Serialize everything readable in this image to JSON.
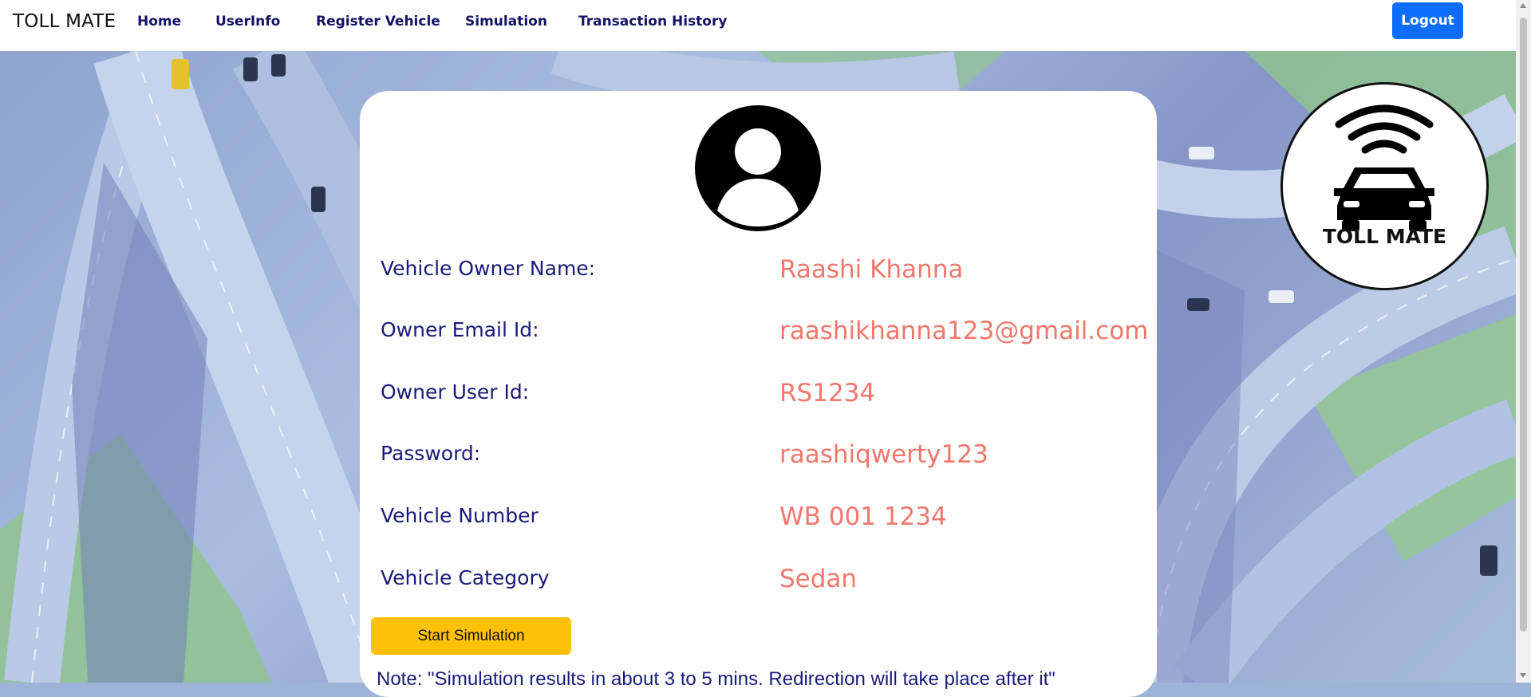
{
  "nav": {
    "brand": "TOLL MATE",
    "links": [
      "Home",
      "UserInfo",
      "Register Vehicle",
      "Simulation",
      "Transaction History"
    ],
    "logout_label": "Logout"
  },
  "profile": {
    "rows": [
      {
        "label": "Vehicle Owner Name:",
        "value": "Raashi Khanna"
      },
      {
        "label": "Owner Email Id:",
        "value": "raashikhanna123@gmail.com"
      },
      {
        "label": "Owner User Id:",
        "value": "RS1234"
      },
      {
        "label": "Password:",
        "value": "raashiqwerty123"
      },
      {
        "label": "Vehicle Number",
        "value": "WB 001 1234"
      },
      {
        "label": "Vehicle Category",
        "value": "Sedan"
      }
    ],
    "start_button_label": "Start Simulation",
    "note": "Note: \"Simulation results in about 3 to 5 mins. Redirection will take place after it\""
  },
  "logo": {
    "text": "TOLL MATE"
  },
  "colors": {
    "nav_link": "#141466",
    "label": "#1a1a7a",
    "value": "#f0776c",
    "logout_bg": "#0d6efd",
    "start_bg": "#ffc107"
  }
}
